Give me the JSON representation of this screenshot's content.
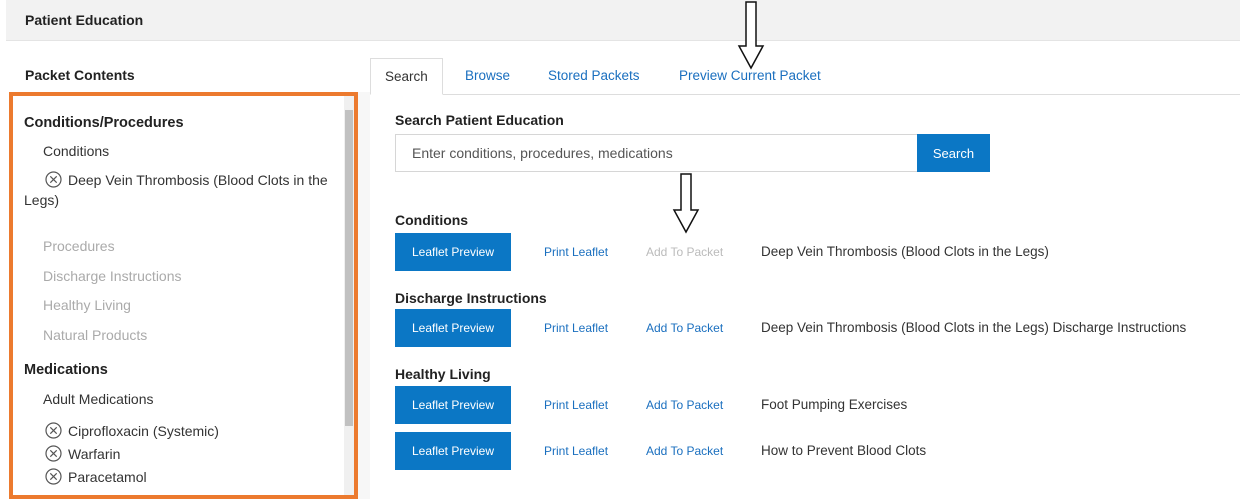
{
  "header": {
    "title": "Patient Education"
  },
  "packet_contents": {
    "title": "Packet Contents",
    "sections": [
      {
        "title": "Conditions/Procedures",
        "categories": [
          {
            "label": "Conditions",
            "items": [
              "Deep Vein Thrombosis (Blood Clots in the",
              "Legs)"
            ]
          },
          {
            "label": "Procedures"
          },
          {
            "label": "Discharge Instructions"
          },
          {
            "label": "Healthy Living"
          },
          {
            "label": "Natural Products"
          }
        ]
      },
      {
        "title": "Medications",
        "categories": [
          {
            "label": "Adult Medications",
            "items": [
              "Ciprofloxacin (Systemic)",
              "Warfarin",
              "Paracetamol"
            ]
          }
        ]
      }
    ]
  },
  "tabs": [
    "Search",
    "Browse",
    "Stored Packets",
    "Preview Current Packet"
  ],
  "search": {
    "title": "Search Patient Education",
    "placeholder": "Enter conditions, procedures, medications",
    "button": "Search"
  },
  "results": {
    "groups": [
      {
        "title": "Conditions",
        "rows": [
          {
            "preview": "Leaflet Preview",
            "print": "Print Leaflet",
            "add": "Add To Packet",
            "add_disabled": true,
            "desc": "Deep Vein Thrombosis (Blood Clots in the Legs)"
          }
        ]
      },
      {
        "title": "Discharge Instructions",
        "rows": [
          {
            "preview": "Leaflet Preview",
            "print": "Print Leaflet",
            "add": "Add To Packet",
            "add_disabled": false,
            "desc": "Deep Vein Thrombosis (Blood Clots in the Legs) Discharge Instructions"
          }
        ]
      },
      {
        "title": "Healthy Living",
        "rows": [
          {
            "preview": "Leaflet Preview",
            "print": "Print Leaflet",
            "add": "Add To Packet",
            "add_disabled": false,
            "desc": "Foot Pumping Exercises"
          },
          {
            "preview": "Leaflet Preview",
            "print": "Print Leaflet",
            "add": "Add To Packet",
            "add_disabled": false,
            "desc": "How to Prevent Blood Clots"
          }
        ]
      }
    ]
  },
  "icons": {
    "remove": "remove-circle-x-icon",
    "annotation": "down-arrow-icon"
  },
  "colors": {
    "accent": "#0b77c5",
    "link": "#1a6fbf",
    "highlight_border": "#ec7a2e",
    "disabled": "#bbbbbb"
  }
}
